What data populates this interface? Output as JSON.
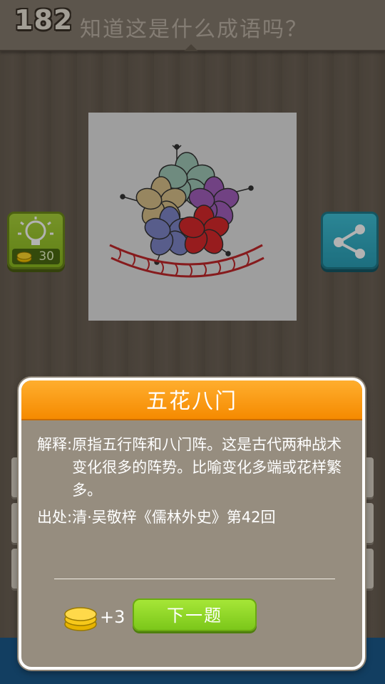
{
  "header": {
    "level": "182",
    "question": "知道这是什么成语吗？"
  },
  "puzzle": {
    "icon": "hibiscus-flowers-icon"
  },
  "hint_button": {
    "icon": "lightbulb-icon",
    "cost_icon": "coins-icon",
    "cost": "30"
  },
  "share_button": {
    "icon": "share-icon"
  },
  "dialog": {
    "title": "五花八门",
    "explain_label": "解释:",
    "explain_text": "原指五行阵和八门阵。这是古代两种战术变化很多的阵势。比喻变化多端或花样繁多。",
    "source": "出处:清·吴敬梓《儒林外史》第42回",
    "reward": "+3",
    "reward_icon": "coins-icon",
    "next_label": "下一题"
  },
  "colors": {
    "dialog_header": "#f58a00",
    "next_button": "#8bd42a",
    "hint_button": "#9ccb2c",
    "share_button": "#35b0c8"
  }
}
